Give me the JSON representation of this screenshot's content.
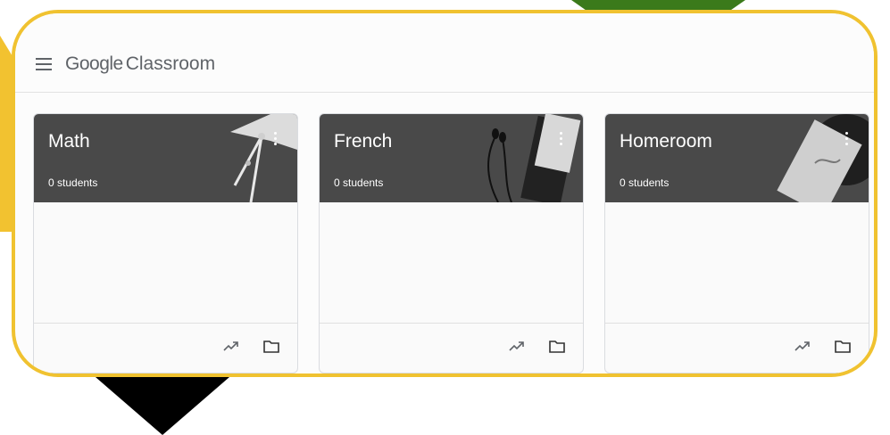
{
  "app": {
    "brand_google": "Google",
    "brand_product": "Classroom",
    "colors": {
      "frame": "#f0c230",
      "card_header": "#494949",
      "deco_green": "#3b7a1b",
      "deco_black": "#000000"
    }
  },
  "header": {
    "menu_icon": "hamburger-menu-icon"
  },
  "classes": [
    {
      "title": "Math",
      "students": "0 students"
    },
    {
      "title": "French",
      "students": "0 students"
    },
    {
      "title": "Homeroom",
      "students": "0 students"
    }
  ],
  "card_footer_icons": [
    "trending-up-icon",
    "folder-icon"
  ],
  "card_header_icon": "more-vert-icon"
}
